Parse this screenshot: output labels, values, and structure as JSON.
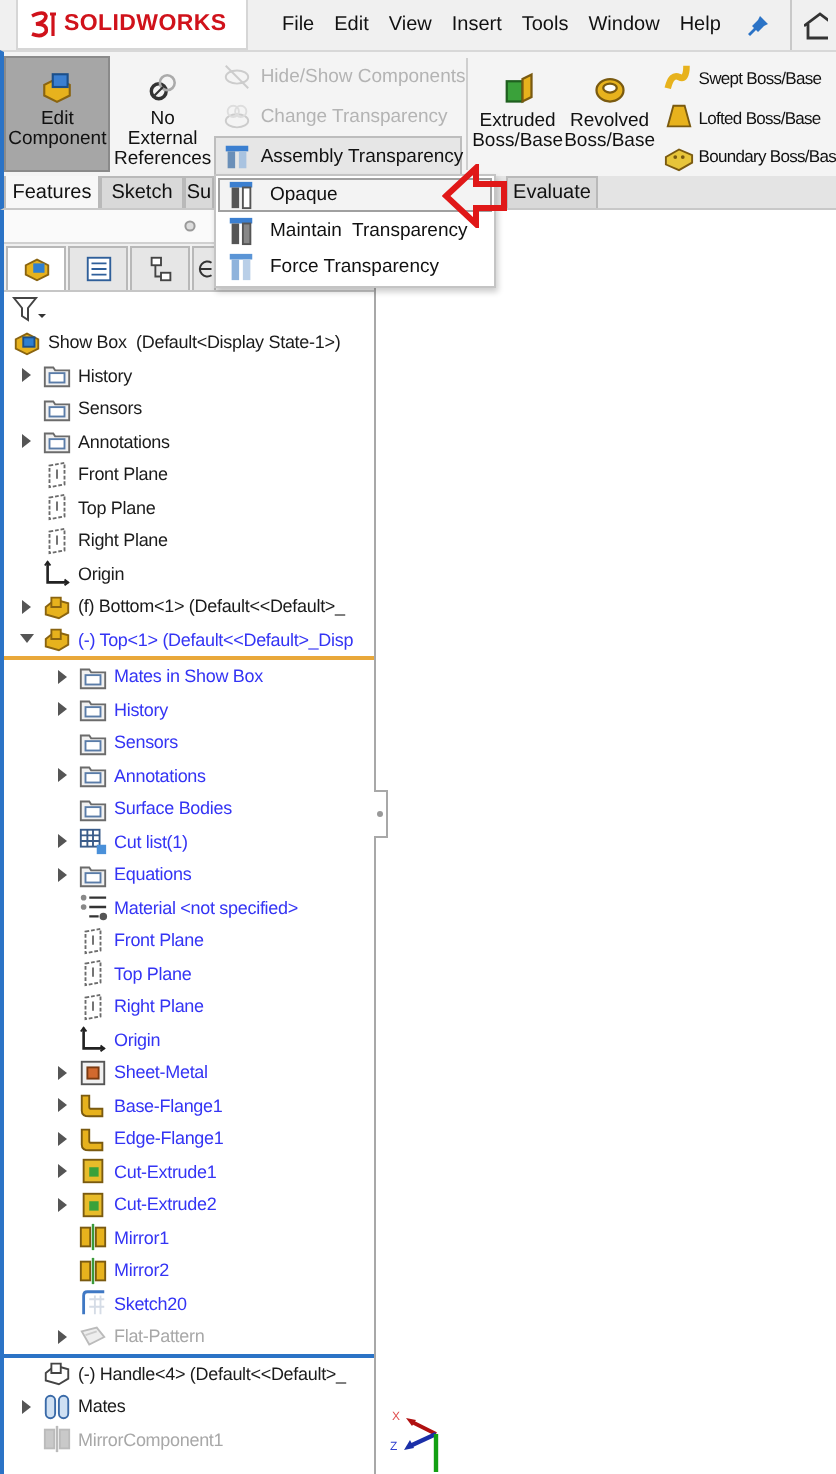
{
  "app": {
    "brand": "SOLIDWORKS"
  },
  "menu": [
    "File",
    "Edit",
    "View",
    "Insert",
    "Tools",
    "Window",
    "Help"
  ],
  "ribbon": {
    "big_buttons": [
      {
        "label": "Edit Component",
        "selected": true
      },
      {
        "label": "No External References",
        "selected": false
      }
    ],
    "small_tools": [
      {
        "label": "Hide/Show Components",
        "disabled": true
      },
      {
        "label": "Change Transparency",
        "disabled": true
      },
      {
        "label": "Assembly Transparency",
        "disabled": false
      }
    ],
    "features": [
      {
        "label": "Extruded Boss/Base",
        "kind": "extrude"
      },
      {
        "label": "Revolved Boss/Base",
        "kind": "revolve"
      }
    ],
    "feature_list": [
      {
        "label": "Swept Boss/Base",
        "kind": "sweep"
      },
      {
        "label": "Lofted Boss/Base",
        "kind": "loft"
      },
      {
        "label": "Boundary Boss/Bas",
        "kind": "boundary"
      }
    ]
  },
  "tabs": [
    {
      "label": "Features",
      "selected": true
    },
    {
      "label": "Sketch",
      "selected": false
    },
    {
      "label": "Su",
      "selected": false
    },
    {
      "label": "Evaluate",
      "selected": false
    }
  ],
  "dropdown": {
    "items": [
      {
        "label": "Opaque",
        "selected": true
      },
      {
        "label": "Maintain  Transparency",
        "selected": false
      },
      {
        "label": "Force Transparency",
        "selected": false
      }
    ]
  },
  "panel_tabs": [
    {
      "selected": true
    },
    {
      "selected": false
    },
    {
      "selected": false
    },
    {
      "selected": false
    }
  ],
  "tree": [
    {
      "label": "Show Box  (Default<Display State-1>)",
      "kind": "assembly",
      "suppressed": false,
      "children": [
        {
          "label": "History",
          "kind": "folder",
          "expanded": false,
          "suppressed": false,
          "editing": false
        },
        {
          "label": "Sensors",
          "kind": "folder",
          "suppressed": false,
          "editing": false
        },
        {
          "label": "Annotations",
          "kind": "folder",
          "expanded": false,
          "suppressed": false,
          "editing": false
        },
        {
          "label": "Front Plane",
          "kind": "plane",
          "suppressed": false,
          "editing": false
        },
        {
          "label": "Top Plane",
          "kind": "plane",
          "suppressed": false,
          "editing": false
        },
        {
          "label": "Right Plane",
          "kind": "plane",
          "suppressed": false,
          "editing": false
        },
        {
          "label": "Origin",
          "kind": "origin",
          "suppressed": false,
          "editing": false
        },
        {
          "label": "(f) Bottom<1> (Default<<Default>_",
          "kind": "part",
          "expanded": false,
          "suppressed": false,
          "editing": false
        },
        {
          "label": "(-) Top<1> (Default<<Default>_Disp",
          "kind": "part",
          "expanded": true,
          "suppressed": false,
          "editing": true,
          "children": [
            {
              "label": "Mates in Show Box",
              "kind": "folder",
              "expanded": false,
              "suppressed": false
            },
            {
              "label": "History",
              "kind": "folder",
              "expanded": false,
              "suppressed": false
            },
            {
              "label": "Sensors",
              "kind": "folder",
              "suppressed": false
            },
            {
              "label": "Annotations",
              "kind": "folder",
              "expanded": false,
              "suppressed": false
            },
            {
              "label": "Surface Bodies",
              "kind": "folder",
              "suppressed": false
            },
            {
              "label": "Cut list(1)",
              "kind": "cutlist",
              "expanded": false,
              "suppressed": false
            },
            {
              "label": "Equations",
              "kind": "folder",
              "expanded": false,
              "suppressed": false
            },
            {
              "label": "Material <not specified>",
              "kind": "material",
              "suppressed": false
            },
            {
              "label": "Front Plane",
              "kind": "plane",
              "suppressed": false
            },
            {
              "label": "Top Plane",
              "kind": "plane",
              "suppressed": false
            },
            {
              "label": "Right Plane",
              "kind": "plane",
              "suppressed": false
            },
            {
              "label": "Origin",
              "kind": "origin",
              "suppressed": false
            },
            {
              "label": "Sheet-Metal",
              "kind": "sheetmetal",
              "expanded": false,
              "suppressed": false
            },
            {
              "label": "Base-Flange1",
              "kind": "flange",
              "expanded": false,
              "suppressed": false
            },
            {
              "label": "Edge-Flange1",
              "kind": "flange",
              "expanded": false,
              "suppressed": false
            },
            {
              "label": "Cut-Extrude1",
              "kind": "cut",
              "expanded": false,
              "suppressed": false
            },
            {
              "label": "Cut-Extrude2",
              "kind": "cut",
              "expanded": false,
              "suppressed": false
            },
            {
              "label": "Mirror1",
              "kind": "mirror",
              "suppressed": false
            },
            {
              "label": "Mirror2",
              "kind": "mirror",
              "suppressed": false
            },
            {
              "label": "Sketch20",
              "kind": "sketch",
              "suppressed": false
            },
            {
              "label": "Flat-Pattern",
              "kind": "flatpattern",
              "expanded": false,
              "suppressed": true
            }
          ]
        },
        {
          "label": "(-) Handle<4> (Default<<Default>_",
          "kind": "ghost",
          "suppressed": false,
          "editing": false
        },
        {
          "label": "Mates",
          "kind": "mates",
          "expanded": false,
          "suppressed": false,
          "editing": false
        },
        {
          "label": "MirrorComponent1",
          "kind": "mirror",
          "suppressed": true,
          "editing": false
        }
      ]
    }
  ],
  "triad": {
    "axes": [
      "X",
      "Z"
    ]
  }
}
